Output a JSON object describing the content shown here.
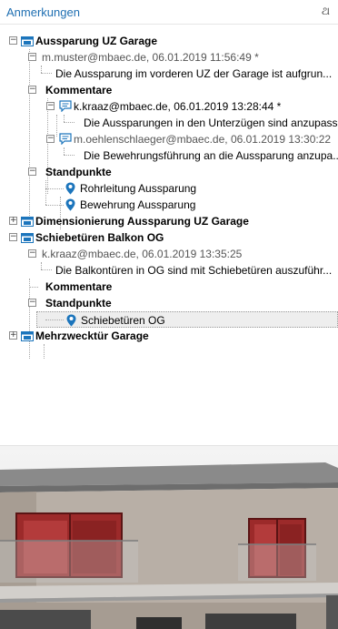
{
  "panel": {
    "title": "Anmerkungen",
    "pin_glyph": "ଥ"
  },
  "tree": {
    "topic1": {
      "label": "Aussparung UZ Garage",
      "author_line": "m.muster@mbaec.de, 06.01.2019 11:56:49 *",
      "text": "Die Aussparung im vorderen UZ der Garage ist aufgrun...",
      "comments_label": "Kommentare",
      "comments": [
        {
          "author_line": "k.kraaz@mbaec.de, 06.01.2019 13:28:44 *",
          "text": "Die Aussparungen in den Unterzügen sind anzupass..."
        },
        {
          "author_line": "m.oehlenschlaeger@mbaec.de, 06.01.2019 13:30:22",
          "text": "Die Bewehrungsführung an die Aussparung anzupa..."
        }
      ],
      "viewpoints_label": "Standpunkte",
      "viewpoints": [
        "Rohrleitung Aussparung",
        "Bewehrung Aussparung"
      ]
    },
    "topic2": {
      "label": "Dimensionierung Aussparung UZ Garage"
    },
    "topic3": {
      "label": "Schiebetüren Balkon OG",
      "author_line": "k.kraaz@mbaec.de, 06.01.2019 13:35:25",
      "text": "Die Balkontüren in OG sind mit Schiebetüren auszuführ...",
      "comments_label": "Kommentare",
      "viewpoints_label": "Standpunkte",
      "viewpoints": [
        "Schiebetüren OG"
      ]
    },
    "topic4": {
      "label": "Mehrzwecktür Garage"
    }
  },
  "icons": {
    "topic": "folder-window-icon",
    "comment": "speech-bubble-icon",
    "viewpoint": "map-pin-icon",
    "expanded": "minus-box",
    "collapsed": "plus-box"
  },
  "colors": {
    "title": "#1f6fb2",
    "icon_blue": "#1c75bc",
    "wall": "#b8afa6",
    "glass_red": "#9c2a2a"
  }
}
